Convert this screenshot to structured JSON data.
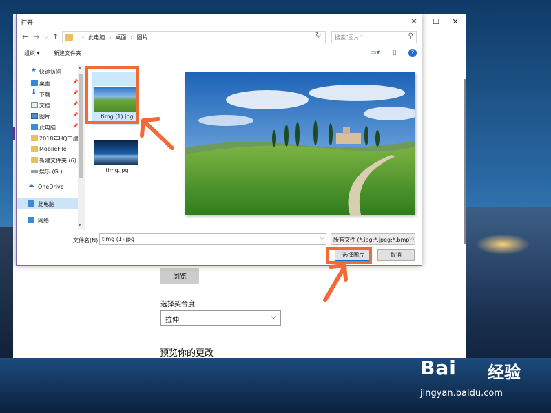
{
  "dialog": {
    "title": "打开",
    "breadcrumbs": [
      "此电脑",
      "桌面",
      "图片"
    ],
    "search_placeholder": "搜索\"图片\"",
    "toolbar": {
      "organize": "组织 ▾",
      "new_folder": "新建文件夹"
    },
    "sidebar": [
      {
        "label": "快速访问",
        "icon": "star-icon"
      },
      {
        "label": "桌面",
        "icon": "desktop-icon",
        "pinned": true
      },
      {
        "label": "下载",
        "icon": "download-icon",
        "pinned": true
      },
      {
        "label": "文档",
        "icon": "document-icon",
        "pinned": true
      },
      {
        "label": "图片",
        "icon": "pictures-icon",
        "pinned": true
      },
      {
        "label": "此电脑",
        "icon": "pc-icon",
        "pinned": true
      },
      {
        "label": "2018年HQ二建全",
        "icon": "folder-icon"
      },
      {
        "label": "MobileFile",
        "icon": "folder-icon"
      },
      {
        "label": "新建文件夹 (6)",
        "icon": "folder-icon"
      },
      {
        "label": "娱乐 (G:)",
        "icon": "drive-icon"
      },
      {
        "label": "OneDrive",
        "icon": "onedrive-icon"
      },
      {
        "label": "此电脑",
        "icon": "pc-icon",
        "selected": true
      },
      {
        "label": "网络",
        "icon": "network-icon"
      }
    ],
    "files": [
      {
        "name": "timg (1).jpg",
        "selected": true
      },
      {
        "name": "timg.jpg",
        "selected": false
      }
    ],
    "filename_label": "文件名(N):",
    "filename_value": "timg (1).jpg",
    "filter_value": "所有文件 (*.jpg;*.jpeg;*.bmp;*.",
    "select_button": "选择图片",
    "cancel_button": "取消"
  },
  "settings": {
    "browse_button": "浏览",
    "fit_label": "选择契合度",
    "fit_value": "拉伸",
    "preview_heading": "预览你的更改"
  },
  "watermark": {
    "brand": "Bai",
    "brand_cn": "经验",
    "url": "jingyan.baidu.com"
  },
  "colors": {
    "highlight": "#f26a35",
    "accent": "#0078d7",
    "selection": "#cce8ff"
  }
}
